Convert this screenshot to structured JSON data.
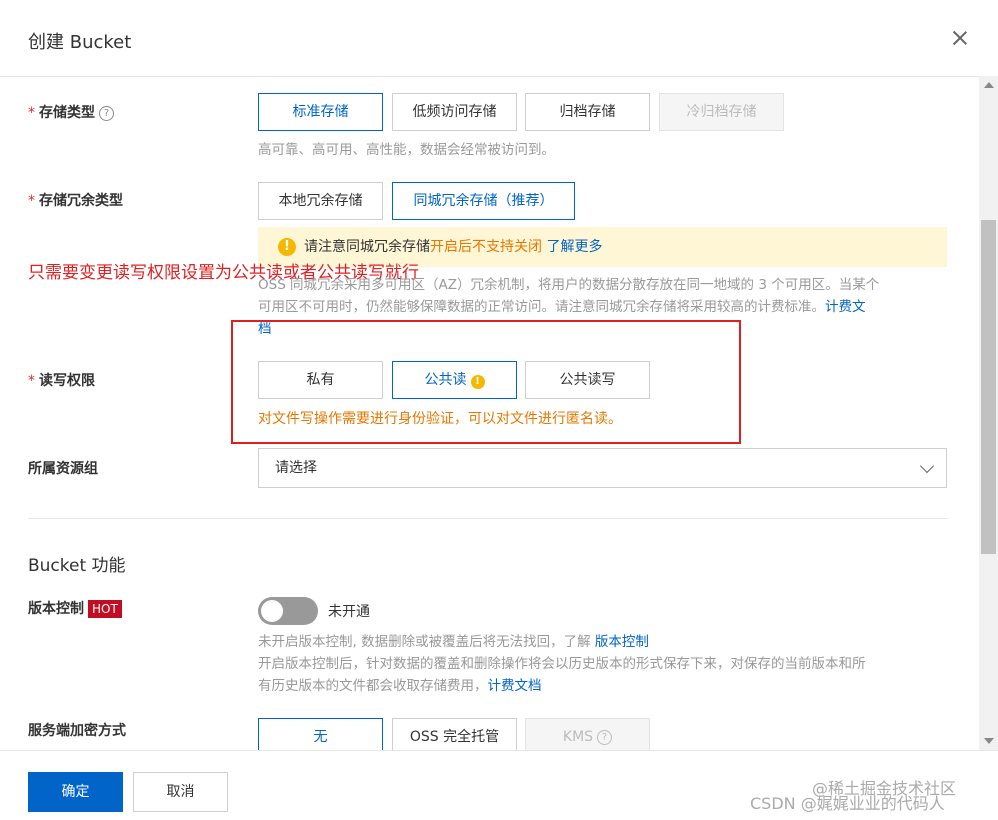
{
  "dialog": {
    "title": "创建 Bucket",
    "close_label": "✕"
  },
  "storage_class": {
    "label": "存储类型",
    "help": "?",
    "options": [
      "标准存储",
      "低频访问存储",
      "归档存储",
      "冷归档存储"
    ],
    "selected": "标准存储",
    "disabled": "冷归档存储",
    "description": "高可靠、高可用、高性能，数据会经常被访问到。"
  },
  "redundancy": {
    "label": "存储冗余类型",
    "options": [
      "本地冗余存储",
      "同城冗余存储（推荐）"
    ],
    "selected": "同城冗余存储（推荐）",
    "notice": {
      "icon": "!",
      "prefix": "请注意同城冗余存储",
      "highlight": "开启后不支持关闭",
      "link": "了解更多"
    },
    "description_1": "OSS 同城冗余采用多可用区（AZ）冗余机制，将用户的数据分散存放在同一地域的 3 个可用区。当某个",
    "description_2": "可用区不可用时，仍然能够保障数据的正常访问。请注意同城冗余存储将采用较高的计费标准。",
    "link_1": "计费文",
    "link_2": "档"
  },
  "annotation": "只需要变更读写权限设置为公共读或者公共读写就行",
  "acl": {
    "label": "读写权限",
    "options": [
      "私有",
      "公共读",
      "公共读写"
    ],
    "selected": "公共读",
    "warn_icon": "!",
    "hint": "对文件写操作需要进行身份验证，可以对文件进行匿名读。"
  },
  "resource_group": {
    "label": "所属资源组",
    "placeholder": "请选择"
  },
  "bucket_features": {
    "title": "Bucket 功能",
    "versioning": {
      "label": "版本控制",
      "badge": "HOT",
      "status": "未开通",
      "enabled": false,
      "desc_1": "未开启版本控制, 数据删除或被覆盖后将无法找回，了解",
      "desc_1_link": "版本控制",
      "desc_2": "开启版本控制后，针对数据的覆盖和删除操作将会以历史版本的形式保存下来，对保存的当前版本和所",
      "desc_3": "有历史版本的文件都会收取存储费用，",
      "desc_3_link": "计费文档"
    },
    "encryption": {
      "label": "服务端加密方式",
      "options": [
        "无",
        "OSS 完全托管",
        "KMS"
      ],
      "selected": "无",
      "disabled": "KMS",
      "help": "?"
    }
  },
  "footer": {
    "confirm": "确定",
    "cancel": "取消"
  },
  "watermark": {
    "line_1": "@稀土掘金技术社区",
    "line_2": "CSDN @娓娓业业的代码人"
  }
}
